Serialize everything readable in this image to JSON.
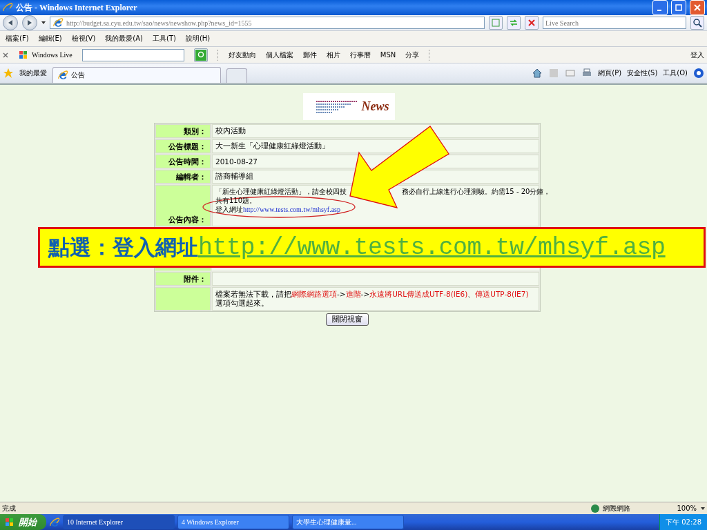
{
  "window": {
    "title": "公告 - Windows Internet Explorer"
  },
  "address_bar": {
    "url": "http://budget.sa.cyu.edu.tw/sao/news/newshow.php?news_id=1555",
    "search_placeholder": "Live Search"
  },
  "menu": [
    "檔案(F)",
    "編輯(E)",
    "檢視(V)",
    "我的最愛(A)",
    "工具(T)",
    "說明(H)"
  ],
  "live_toolbar": {
    "brand": "Windows Live",
    "links": [
      "好友動向",
      "個人檔案",
      "郵件",
      "相片",
      "行事曆",
      "MSN",
      "分享"
    ],
    "sign_in": "登入"
  },
  "favorites_bar": {
    "favorites": "我的最愛",
    "tabs": [
      {
        "label": "公告",
        "selected": true
      }
    ],
    "commands": [
      "網頁(P)",
      "安全性(S)",
      "工具(O)"
    ]
  },
  "page": {
    "logo": "News",
    "rows": [
      {
        "label": "類別：",
        "value": "校內活動"
      },
      {
        "label": "公告標題：",
        "value": "大一新生「心理健康紅綠燈活動」"
      },
      {
        "label": "公告時間：",
        "value": "2010-08-27"
      },
      {
        "label": "編輯者：",
        "value": "諮商輔導組"
      }
    ],
    "content": {
      "label": "公告內容：",
      "line_1_start": "「新生心理健康紅綠燈活動」，請全校四技",
      "line_1_end": "務必自行上線進行心理測驗。約需15 - 20分鐘，",
      "line_2": "共有110題。",
      "link_label": "登入網址",
      "link": "http://www.tests.com.tw/mhsyf.asp"
    },
    "attachment": {
      "label": "附件："
    },
    "note": [
      {
        "kind": "plain",
        "text": "檔案若無法下載，請把"
      },
      {
        "kind": "emphasis",
        "text": "網際網路選項"
      },
      {
        "kind": "plain",
        "text": "->"
      },
      {
        "kind": "emphasis",
        "text": "進階"
      },
      {
        "kind": "plain",
        "text": "->"
      },
      {
        "kind": "emphasis",
        "text": "永遠將URL傳送成UTF-8(IE6)"
      },
      {
        "kind": "plain",
        "text": "、"
      },
      {
        "kind": "emphasis",
        "text": "傳送UTP-8(IE7)"
      },
      {
        "kind": "plain",
        "text": "選項勾選起來。"
      }
    ],
    "close_button": "關閉視窗"
  },
  "callout": {
    "label": "點選：登入網址",
    "url": "http://www.tests.com.tw/mhsyf.asp"
  },
  "status_bar": {
    "status": "完成",
    "zone": "網際網路",
    "zoom": "100%"
  },
  "taskbar": {
    "start": "開始",
    "tasks": [
      {
        "label": "10 Internet Explorer",
        "selected": true
      },
      {
        "label": "4 Windows Explorer",
        "selected": false
      },
      {
        "label": "大學生心理健康量...",
        "selected": false
      }
    ],
    "clock": "下午 02:28"
  }
}
